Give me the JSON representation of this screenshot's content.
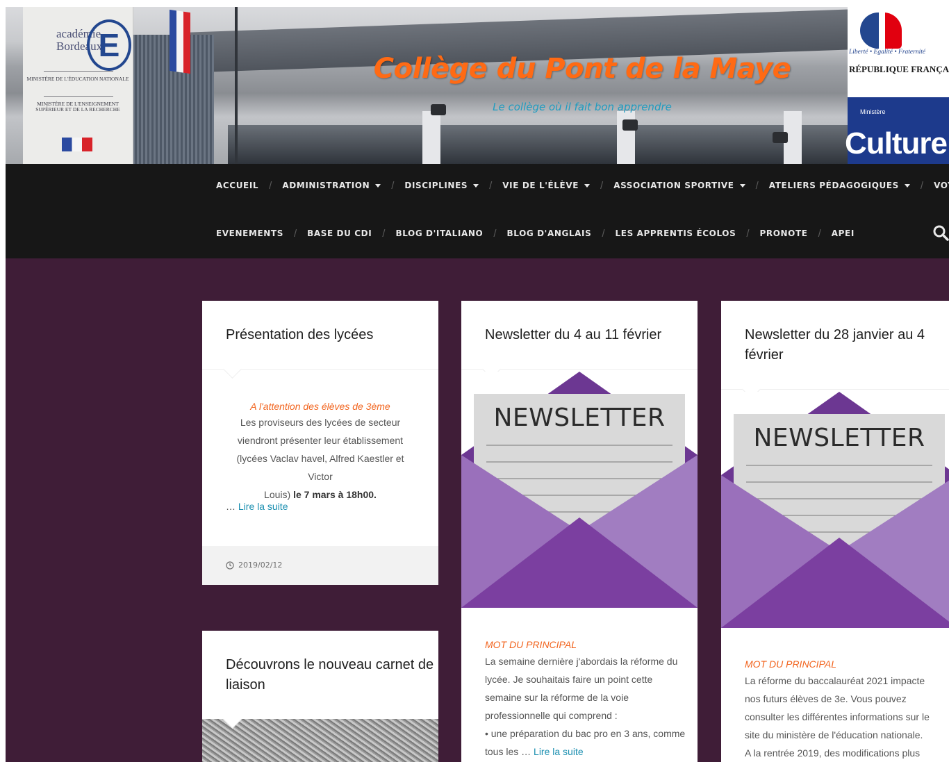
{
  "header": {
    "site_title": "Collège du Pont de la Maye",
    "tagline": "Le collège où il fait bon apprendre",
    "logo_left": {
      "academie": "académie",
      "bordeaux": "Bordeaux",
      "ministere_1": "MINISTÈRE DE L'ÉDUCATION NATIONALE",
      "ministere_2": "MINISTÈRE DE L'ENSEIGNEMENT SUPÉRIEUR ET DE LA RECHERCHE"
    },
    "logo_right": {
      "devise": "Liberté • Égalité • Fraternité",
      "republique": "RÉPUBLIQUE FRANÇAISE",
      "ministere": "Ministère",
      "culture": "Culture"
    }
  },
  "nav": {
    "row1": [
      {
        "label": "ACCUEIL",
        "dropdown": false
      },
      {
        "label": "ADMINISTRATION",
        "dropdown": true
      },
      {
        "label": "DISCIPLINES",
        "dropdown": true
      },
      {
        "label": "VIE DE L'ÉLÈVE",
        "dropdown": true
      },
      {
        "label": "ASSOCIATION SPORTIVE",
        "dropdown": true
      },
      {
        "label": "ATELIERS PÉDAGOGIQUES",
        "dropdown": true
      },
      {
        "label": "VOYAGES",
        "dropdown": true
      }
    ],
    "row2": [
      {
        "label": "EVENEMENTS"
      },
      {
        "label": "BASE DU CDI"
      },
      {
        "label": "BLOG D'ITALIANO"
      },
      {
        "label": "BLOG D'ANGLAIS"
      },
      {
        "label": "LES APPRENTIS ÉCOLOS"
      },
      {
        "label": "PRONOTE"
      },
      {
        "label": "APEI"
      }
    ],
    "search_icon": "search-icon"
  },
  "posts": [
    {
      "title": "Présentation des lycées",
      "kicker": "A l'attention des élèves de 3ème",
      "body_1": "Les proviseurs des lycées de secteur",
      "body_2": "viendront présenter leur établissement",
      "body_3": "(lycées Vaclav havel, Alfred Kaestler et Victor",
      "body_4_pre": "Louis) ",
      "body_4_bold": "le 7  mars à 18h00.",
      "ellipsis": "… ",
      "read_more": "Lire la suite",
      "date": "2019/02/12"
    },
    {
      "title": "Newsletter du 4 au 11 février",
      "image_word": "NEWSLETTER",
      "kicker": "MOT DU PRINCIPAL",
      "body": [
        "La semaine dernière j'abordais la réforme du",
        "lycée. Je souhaitais faire un point cette",
        "semaine sur la réforme de la voie",
        "professionnelle qui comprend :",
        "• une préparation du bac pro en 3 ans, comme"
      ],
      "last_line_pre": "tous les … ",
      "read_more": "Lire la suite"
    },
    {
      "title_line1": "Newsletter du 28 janvier au 4",
      "title_line2": "février",
      "image_word": "NEWSLETTER",
      "kicker": "MOT DU PRINCIPAL",
      "body": [
        "La réforme du baccalauréat 2021 impacte",
        "nos futurs élèves de 3e. Vous pouvez",
        "consulter les différentes informations sur le",
        "site du ministère de l'éducation nationale.",
        "A la rentrée 2019, des modifications plus"
      ]
    },
    {
      "title_line1": "Découvrons le nouveau carnet de",
      "title_line2": "liaison"
    }
  ],
  "colors": {
    "background": "#3f1d37",
    "nav_bg": "#171717",
    "title_orange": "#ff6a14",
    "tagline_blue": "#1f9cc0",
    "kicker_orange": "#f2641e",
    "link_blue": "#1b8fb0",
    "envelope_purple": "#7b3fa0"
  }
}
